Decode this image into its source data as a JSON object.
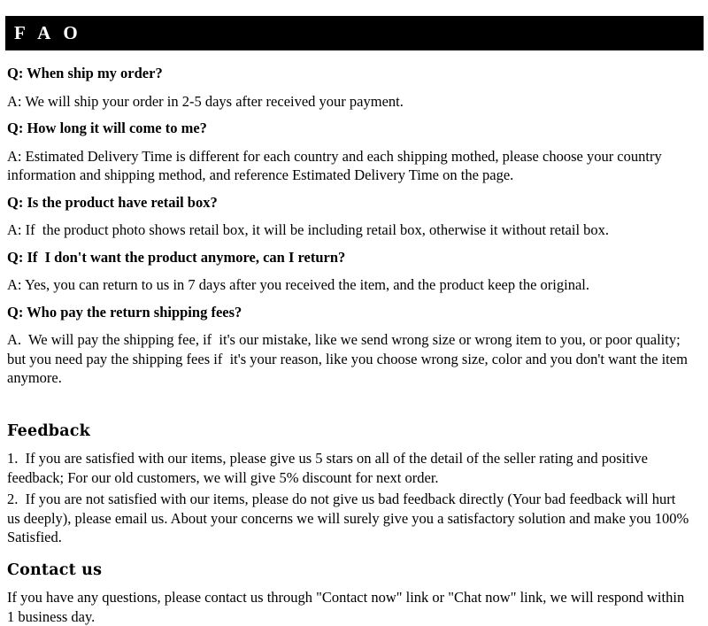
{
  "header": {
    "title": "F A O"
  },
  "faq": [
    {
      "question": "Q: When ship my order?",
      "answer": "A: We will ship your order in 2-5 days after received your payment."
    },
    {
      "question": "Q: How long it will come to me?",
      "answer": "A: Estimated Delivery Time is different for each country and each shipping mothed, please choose your country information and shipping method, and reference Estimated Delivery Time on the page."
    },
    {
      "question": "Q: Is the product have retail box?",
      "answer": "A: If  the product photo shows retail box, it will be including retail box, otherwise it without retail box."
    },
    {
      "question": "Q: If  I don't want the product anymore, can I return?",
      "answer": "A: Yes, you can return to us in 7 days after you received the item, and the product keep the original."
    },
    {
      "question": "Q: Who pay the return shipping fees?",
      "answer": "A.  We will pay the shipping fee, if  it's our mistake, like we send wrong size or wrong item to you, or poor quality; but you need pay the shipping fees if  it's your reason, like you choose wrong size, color and you don't want the item anymore."
    }
  ],
  "feedback": {
    "title": "Feedback",
    "items": [
      "1.  If you are satisfied with our items, please give us 5 stars on all of the detail of the seller rating and positive feedback; For our old customers, we will give 5% discount for next order.",
      "2.  If you are not satisfied with our items, please do not give us bad feedback directly (Your bad feedback will hurt us deeply), please email us. About your concerns we will surely give you a satisfactory solution and make you 100% Satisfied."
    ]
  },
  "contact": {
    "title": "Contact us",
    "text": "If you have any questions, please contact us through \"Contact now\" link or \"Chat now\" link, we will respond within 1 business day."
  },
  "colors": {
    "header_background": "#000000",
    "header_text": "#ffffff",
    "page_background": "#ffffff",
    "body_text": "#000000"
  }
}
